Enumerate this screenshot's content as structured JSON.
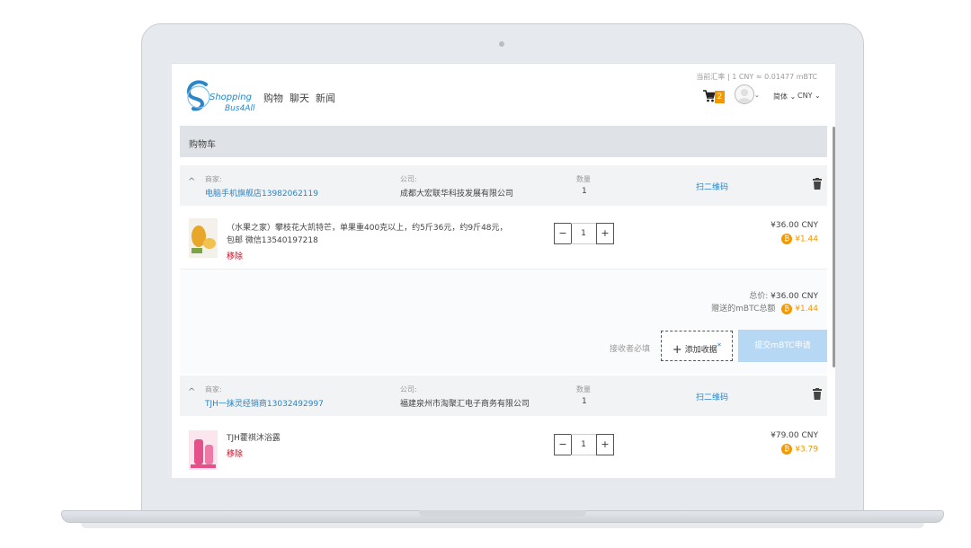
{
  "header": {
    "logo_line1": "Shopping",
    "logo_line2": "Bus4All",
    "nav": [
      "购物",
      "聊天",
      "新闻"
    ],
    "rate_text": "当前汇率 | 1 CNY ≈ 0.01477 mBTC",
    "cart_count": "2",
    "language": "简体 ⌄",
    "currency": "CNY ⌄",
    "avatar_caret": "⌄"
  },
  "cart": {
    "title": "购物车"
  },
  "labels": {
    "merchant": "商家:",
    "company": "公司:",
    "quantity": "数量",
    "scan_qr": "扫二维码",
    "remove": "移除"
  },
  "orders": [
    {
      "merchant": "电脑手机旗舰店13982062119",
      "company": "成都大宏联华科技发展有限公司",
      "quantity": "1",
      "item": {
        "name": "（水果之家）攀枝花大凯特芒，单果重400克以上，约5斤36元，约9斤48元，包邮 微信13540197218",
        "qty": "1",
        "price": "¥36.00 CNY",
        "btc": "¥1.44"
      },
      "summary": {
        "total_label": "总价:",
        "total_value": "¥36.00 CNY",
        "btc_total_label": "赠送的mBTC总额",
        "btc_total_value": "¥1.44",
        "receiver_note": "接收者必填",
        "add_receiver": "添加收据",
        "submit": "提交mBTC申请"
      }
    },
    {
      "merchant": "TJH一抹灵经销商13032492997",
      "company": "福建泉州市淘聚汇电子商务有限公司",
      "quantity": "1",
      "item": {
        "name": "TJH藿祺沐浴露",
        "qty": "1",
        "price": "¥79.00 CNY",
        "btc": "¥3.79"
      }
    }
  ],
  "colors": {
    "accent": "#2a86c6",
    "bitcoin": "#f39800",
    "remove": "#d0021b",
    "submit_disabled": "#b7d8f5"
  },
  "icons": {
    "cart": "cart-icon",
    "trash": "trash-icon",
    "collapse": "chevron-up-icon",
    "bitcoin": "bitcoin-icon",
    "plus": "plus-icon"
  }
}
